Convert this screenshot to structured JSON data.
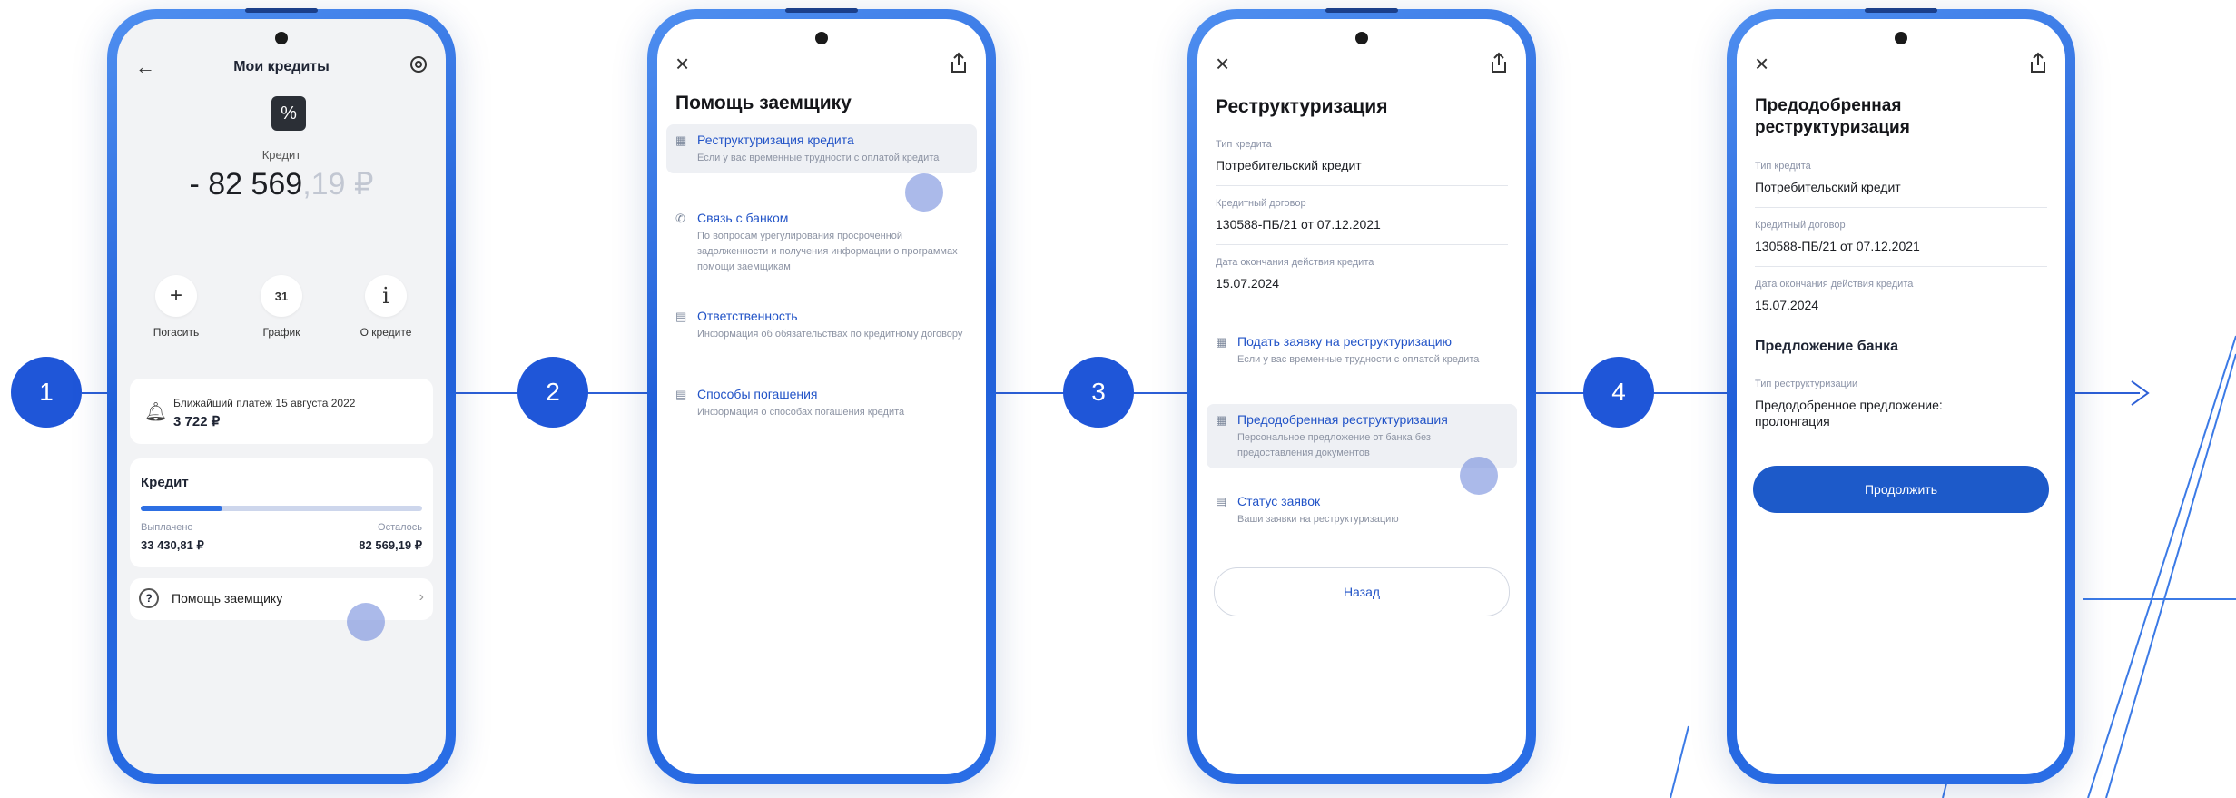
{
  "steps": [
    "1",
    "2",
    "3",
    "4"
  ],
  "colors": {
    "accent": "#1f56d8",
    "link": "#2153c7",
    "phone_frame": "#2a6ee6"
  },
  "screen1": {
    "back_icon": "arrow-left-icon",
    "title": "Мои кредиты",
    "settings_icon": "gear-icon",
    "badge_symbol": "%",
    "subtitle": "Кредит",
    "amount_main": "- 82 569",
    "amount_decimal": ",19 ₽",
    "actions": [
      {
        "icon": "+",
        "label": "Погасить"
      },
      {
        "icon": "31",
        "label": "График"
      },
      {
        "icon": "i",
        "label": "О кредите"
      }
    ],
    "payment": {
      "label": "Ближайший платеж 15 августа 2022",
      "amount": "3 722 ₽"
    },
    "credit": {
      "title": "Кредит",
      "paid_label": "Выплачено",
      "paid_value": "33 430,81 ₽",
      "left_label": "Осталось",
      "left_value": "82 569,19 ₽",
      "paid_fraction": 0.29
    },
    "help": {
      "icon": "?",
      "label": "Помощь заемщику",
      "chevron": "›"
    }
  },
  "screen2": {
    "close_icon": "×",
    "share_icon": "share-icon",
    "title": "Помощь заемщику",
    "items": [
      {
        "title": "Реструктуризация кредита",
        "desc": "Если у вас временные трудности с оплатой кредита"
      },
      {
        "title": "Связь с банком",
        "desc": "По вопросам урегулирования просроченной задолженности и получения информации о программах помощи заемщикам"
      },
      {
        "title": "Ответственность",
        "desc": "Информация об обязательствах по кредитному договору"
      },
      {
        "title": "Способы погашения",
        "desc": "Информация о способах погашения кредита"
      }
    ]
  },
  "screen3": {
    "close_icon": "×",
    "title": "Реструктуризация",
    "fields": [
      {
        "label": "Тип кредита",
        "value": "Потребительский кредит"
      },
      {
        "label": "Кредитный договор",
        "value": "130588-ПБ/21 от 07.12.2021"
      },
      {
        "label": "Дата окончания действия кредита",
        "value": "15.07.2024"
      }
    ],
    "items": [
      {
        "title": "Подать заявку на реструктуризацию",
        "desc": "Если у вас временные трудности с оплатой кредита"
      },
      {
        "title": "Предодобренная реструктуризация",
        "desc": "Персональное предложение от банка без предоставления документов"
      },
      {
        "title": "Статус заявок",
        "desc": "Ваши заявки на реструктуризацию"
      }
    ],
    "back_button": "Назад"
  },
  "screen4": {
    "close_icon": "×",
    "title": "Предодобренная реструктуризация",
    "fields": [
      {
        "label": "Тип кредита",
        "value": "Потребительский кредит"
      },
      {
        "label": "Кредитный договор",
        "value": "130588-ПБ/21 от 07.12.2021"
      },
      {
        "label": "Дата окончания действия кредита",
        "value": "15.07.2024"
      }
    ],
    "offer_title": "Предложение банка",
    "offer_field": {
      "label": "Тип реструктуризации",
      "value": "Предодобренное предложение: пролонгация"
    },
    "continue_button": "Продолжить"
  }
}
